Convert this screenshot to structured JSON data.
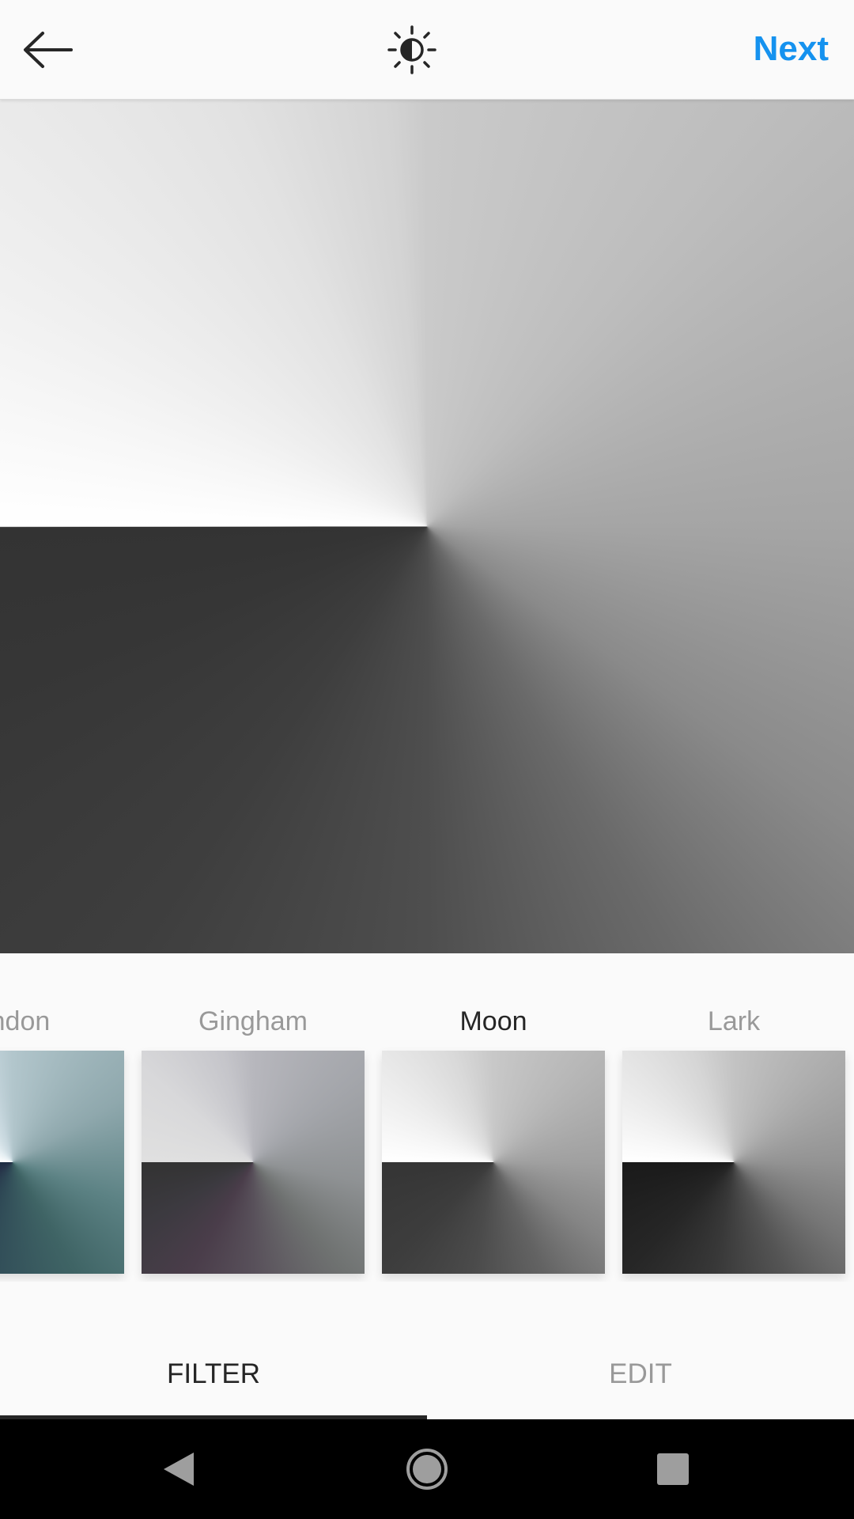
{
  "topbar": {
    "back_icon": "back-arrow-icon",
    "adjust_icon": "brightness-icon",
    "next_label": "Next",
    "accent_color": "#1592ef"
  },
  "filters": {
    "items": [
      {
        "label": "endon",
        "selected": false
      },
      {
        "label": "Gingham",
        "selected": false
      },
      {
        "label": "Moon",
        "selected": true
      },
      {
        "label": "Lark",
        "selected": false
      }
    ]
  },
  "tabs": {
    "filter_label": "FILTER",
    "edit_label": "EDIT",
    "active": "FILTER"
  },
  "navbar": {
    "back_icon": "triangle-back-icon",
    "home_icon": "circle-home-icon",
    "recents_icon": "square-recents-icon"
  }
}
